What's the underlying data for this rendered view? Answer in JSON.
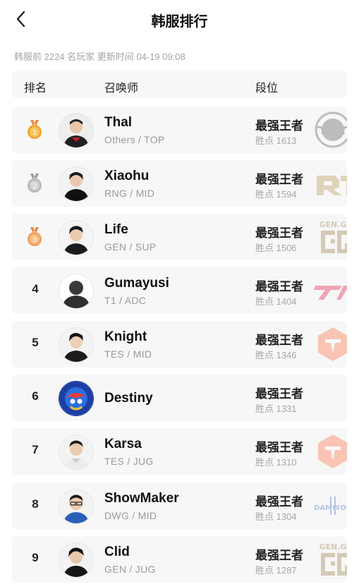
{
  "header": {
    "title": "韩服排行"
  },
  "meta": "韩服前 2224 名玩家 更新时间 04-19 09:08",
  "columns": {
    "rank": "排名",
    "summoner": "召唤师",
    "tier": "段位"
  },
  "rows": [
    {
      "rank": "1",
      "medal": "gold",
      "name": "Thal",
      "team": "Others / TOP",
      "tier": "最强王者",
      "points": "胜点 1613",
      "logo": "club-emblem"
    },
    {
      "rank": "2",
      "medal": "silver",
      "name": "Xiaohu",
      "team": "RNG / MID",
      "tier": "最强王者",
      "points": "胜点 1594",
      "logo": "rng-logo"
    },
    {
      "rank": "3",
      "medal": "bronze",
      "name": "Life",
      "team": "GEN / SUP",
      "tier": "最强王者",
      "points": "胜点 1506",
      "logo": "geng-logo",
      "logo_text": "GEN.G"
    },
    {
      "rank": "4",
      "name": "Gumayusi",
      "team": "T1 / ADC",
      "tier": "最强王者",
      "points": "胜点 1404",
      "logo": "t1-logo"
    },
    {
      "rank": "5",
      "name": "Knight",
      "team": "TES / MID",
      "tier": "最强王者",
      "points": "胜点 1346",
      "logo": "tes-logo"
    },
    {
      "rank": "6",
      "name": "Destiny",
      "team": "",
      "tier": "最强王者",
      "points": "胜点 1331",
      "logo": ""
    },
    {
      "rank": "7",
      "name": "Karsa",
      "team": "TES / JUG",
      "tier": "最强王者",
      "points": "胜点 1310",
      "logo": "tes-logo"
    },
    {
      "rank": "8",
      "name": "ShowMaker",
      "team": "DWG / MID",
      "tier": "最强王者",
      "points": "胜点 1304",
      "logo": "dwg-logo",
      "logo_text": "DAMWON"
    },
    {
      "rank": "9",
      "name": "Clid",
      "team": "GEN / JUG",
      "tier": "最强王者",
      "points": "胜点 1287",
      "logo": "geng-logo",
      "logo_text": "GEN.G"
    }
  ],
  "colors": {
    "gold": "#f3a531",
    "silver": "#b9b9b9",
    "bronze": "#f0a15c",
    "row_bg": "#f7f7f7",
    "muted": "#a3a3a3"
  }
}
